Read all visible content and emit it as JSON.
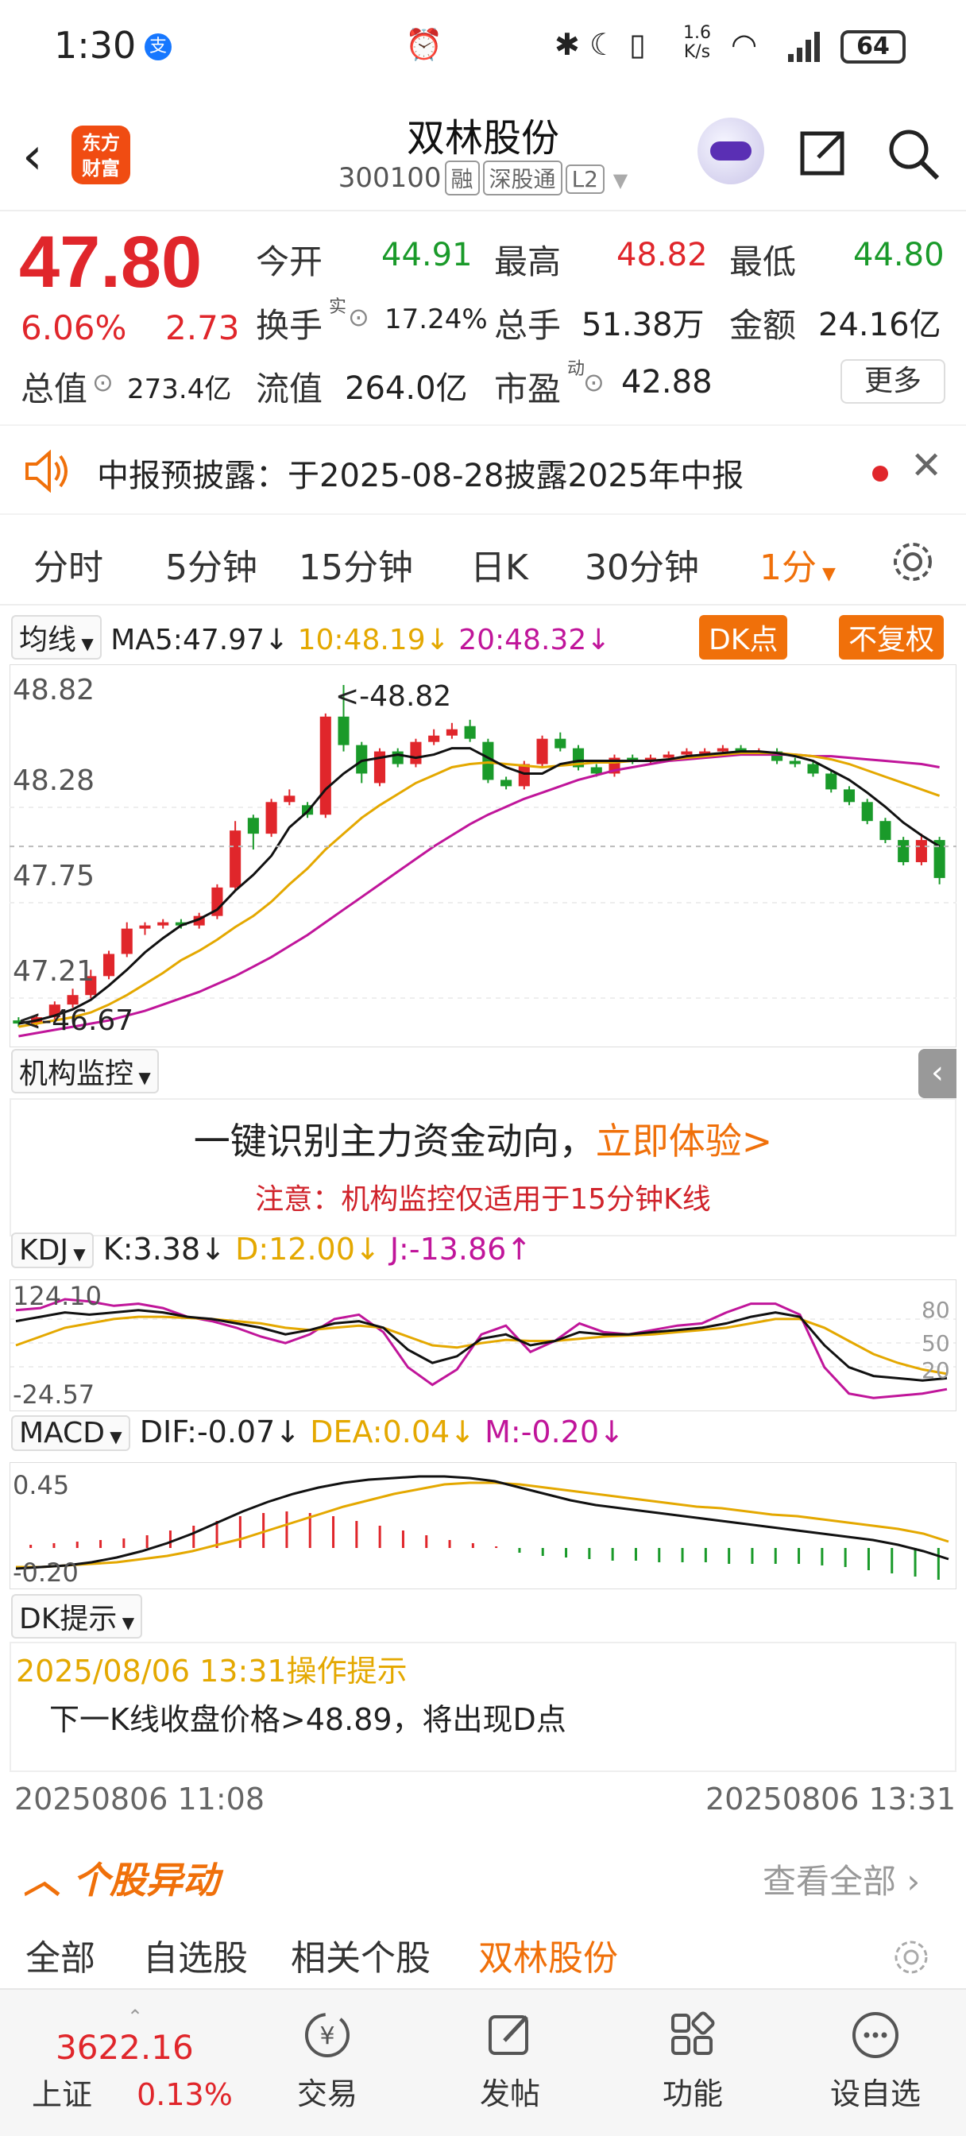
{
  "status_bar": {
    "time": "1:30",
    "pay_glyph": "支",
    "speed_top": "1.6",
    "speed_bottom": "K/s",
    "battery": "64"
  },
  "header": {
    "logo_line1": "东方",
    "logo_line2": "财富",
    "name": "双林股份",
    "code": "300100",
    "tags": [
      "融",
      "深股通",
      "L2"
    ]
  },
  "quote": {
    "price": "47.80",
    "pct": "6.06%",
    "change": "2.73",
    "open_label": "今开",
    "open": "44.91",
    "high_label": "最高",
    "high": "48.82",
    "low_label": "最低",
    "low": "44.80",
    "turnover_label": "换手",
    "turnover_sup": "实",
    "turnover": "17.24%",
    "volume_label": "总手",
    "volume": "51.38万",
    "amount_label": "金额",
    "amount": "24.16亿",
    "mcap_label": "总值",
    "mcap": "273.4亿",
    "float_label": "流值",
    "float": "264.0亿",
    "pe_label": "市盈",
    "pe_sup": "动",
    "pe": "42.88",
    "more": "更多"
  },
  "notice": {
    "text": "中报预披露：于2025-08-28披露2025年中报"
  },
  "periods": [
    "分时",
    "5分钟",
    "15分钟",
    "日K",
    "30分钟",
    "1分"
  ],
  "main_indicator": {
    "selector": "均线",
    "ma5": "MA5:47.97",
    "ma10": "10:48.19",
    "ma20": "20:48.32",
    "dk_button": "DK点",
    "fq_button": "不复权"
  },
  "price_axis": [
    "48.82",
    "48.28",
    "47.75",
    "47.21"
  ],
  "price_labels": {
    "high_marker": "<-48.82",
    "low_marker": "<-46.67"
  },
  "colors": {
    "up": "#e0262b",
    "down": "#1a9a2a",
    "accent": "#f0700a",
    "ma5": "#111111",
    "ma10": "#e4a800",
    "ma20": "#c0159a"
  },
  "institution": {
    "selector": "机构监控",
    "headline": "一键识别主力资金动向，",
    "cta": "立即体验>",
    "note": "注意：机构监控仅适用于15分钟K线"
  },
  "kdj": {
    "selector": "KDJ",
    "k": "K:3.38",
    "d": "D:12.00",
    "j": "J:-13.86",
    "top": "124.10",
    "bottom": "-24.57",
    "levels": [
      "80",
      "50",
      "20"
    ]
  },
  "macd": {
    "selector": "MACD",
    "dif": "DIF:-0.07",
    "dea": "DEA:0.04",
    "m": "M:-0.20",
    "top": "0.45",
    "bottom": "-0.20"
  },
  "dk_hint": {
    "selector": "DK提示",
    "title": "2025/08/06 13:31操作提示",
    "body": "下一K线收盘价格>48.89，将出现D点"
  },
  "time_range": {
    "start": "20250806 11:08",
    "end": "20250806 13:31"
  },
  "movers": {
    "title": "个股异动",
    "view_all": "查看全部"
  },
  "filters": [
    "全部",
    "自选股",
    "相关个股",
    "双林股份"
  ],
  "bottom_nav": {
    "index_value": "3622.16",
    "index_name": "上证",
    "index_pct": "0.13%",
    "items": [
      "交易",
      "发帖",
      "功能",
      "设自选"
    ]
  },
  "chart_data": {
    "type": "candlestick",
    "ylim": [
      46.6,
      48.85
    ],
    "candles": [
      [
        46.7,
        46.68,
        46.72,
        46.66
      ],
      [
        46.68,
        46.72,
        46.74,
        46.66
      ],
      [
        46.72,
        46.8,
        46.82,
        46.7
      ],
      [
        46.8,
        46.86,
        46.9,
        46.78
      ],
      [
        46.86,
        46.98,
        47.02,
        46.84
      ],
      [
        46.98,
        47.12,
        47.14,
        46.96
      ],
      [
        47.12,
        47.28,
        47.32,
        47.1
      ],
      [
        47.28,
        47.3,
        47.32,
        47.24
      ],
      [
        47.3,
        47.32,
        47.34,
        47.28
      ],
      [
        47.32,
        47.3,
        47.34,
        47.28
      ],
      [
        47.3,
        47.36,
        47.38,
        47.28
      ],
      [
        47.36,
        47.54,
        47.56,
        47.34
      ],
      [
        47.54,
        47.9,
        47.96,
        47.52
      ],
      [
        47.98,
        47.88,
        48.0,
        47.78
      ],
      [
        47.88,
        48.08,
        48.1,
        47.86
      ],
      [
        48.08,
        48.12,
        48.16,
        48.06
      ],
      [
        48.06,
        48.0,
        48.08,
        47.98
      ],
      [
        48.0,
        48.62,
        48.64,
        47.98
      ],
      [
        48.62,
        48.44,
        48.82,
        48.4
      ],
      [
        48.44,
        48.26,
        48.46,
        48.2
      ],
      [
        48.2,
        48.4,
        48.42,
        48.18
      ],
      [
        48.4,
        48.32,
        48.42,
        48.3
      ],
      [
        48.32,
        48.46,
        48.48,
        48.3
      ],
      [
        48.46,
        48.5,
        48.54,
        48.44
      ],
      [
        48.5,
        48.54,
        48.58,
        48.48
      ],
      [
        48.56,
        48.48,
        48.6,
        48.46
      ],
      [
        48.46,
        48.22,
        48.48,
        48.2
      ],
      [
        48.22,
        48.18,
        48.24,
        48.16
      ],
      [
        48.18,
        48.32,
        48.34,
        48.16
      ],
      [
        48.32,
        48.48,
        48.5,
        48.3
      ],
      [
        48.48,
        48.42,
        48.52,
        48.4
      ],
      [
        48.42,
        48.3,
        48.44,
        48.28
      ],
      [
        48.3,
        48.26,
        48.32,
        48.24
      ],
      [
        48.26,
        48.36,
        48.38,
        48.24
      ],
      [
        48.36,
        48.34,
        48.38,
        48.32
      ],
      [
        48.34,
        48.36,
        48.38,
        48.32
      ],
      [
        48.36,
        48.38,
        48.4,
        48.34
      ],
      [
        48.38,
        48.4,
        48.42,
        48.36
      ],
      [
        48.4,
        48.4,
        48.42,
        48.38
      ],
      [
        48.4,
        48.42,
        48.44,
        48.38
      ],
      [
        48.42,
        48.4,
        48.44,
        48.38
      ],
      [
        48.4,
        48.4,
        48.42,
        48.38
      ],
      [
        48.4,
        48.34,
        48.42,
        48.32
      ],
      [
        48.34,
        48.32,
        48.36,
        48.3
      ],
      [
        48.32,
        48.26,
        48.34,
        48.24
      ],
      [
        48.26,
        48.16,
        48.28,
        48.14
      ],
      [
        48.16,
        48.08,
        48.18,
        48.06
      ],
      [
        48.08,
        47.96,
        48.1,
        47.94
      ],
      [
        47.96,
        47.84,
        47.98,
        47.82
      ],
      [
        47.84,
        47.7,
        47.86,
        47.68
      ],
      [
        47.7,
        47.84,
        47.88,
        47.68
      ],
      [
        47.84,
        47.6,
        47.86,
        47.56
      ]
    ],
    "ma5": [
      46.68,
      46.7,
      46.73,
      46.77,
      46.83,
      46.92,
      47.02,
      47.13,
      47.22,
      47.3,
      47.34,
      47.4,
      47.52,
      47.62,
      47.74,
      47.92,
      48.02,
      48.16,
      48.26,
      48.34,
      48.36,
      48.38,
      48.36,
      48.38,
      48.42,
      48.42,
      48.36,
      48.3,
      48.26,
      48.26,
      48.32,
      48.34,
      48.34,
      48.34,
      48.34,
      48.34,
      48.35,
      48.37,
      48.38,
      48.39,
      48.4,
      48.4,
      48.39,
      48.37,
      48.34,
      48.28,
      48.22,
      48.14,
      48.05,
      47.95,
      47.87,
      47.8
    ],
    "ma10": [
      46.66,
      46.68,
      46.7,
      46.72,
      46.75,
      46.8,
      46.86,
      46.93,
      47.0,
      47.08,
      47.14,
      47.21,
      47.29,
      47.36,
      47.45,
      47.56,
      47.66,
      47.78,
      47.88,
      47.98,
      48.06,
      48.13,
      48.2,
      48.25,
      48.3,
      48.32,
      48.33,
      48.32,
      48.31,
      48.3,
      48.31,
      48.32,
      48.33,
      48.33,
      48.34,
      48.34,
      48.35,
      48.36,
      48.37,
      48.38,
      48.39,
      48.39,
      48.39,
      48.38,
      48.37,
      48.35,
      48.32,
      48.28,
      48.24,
      48.2,
      48.16,
      48.12
    ],
    "ma20": [
      46.6,
      46.62,
      46.64,
      46.66,
      46.68,
      46.7,
      46.73,
      46.76,
      46.8,
      46.84,
      46.88,
      46.93,
      46.98,
      47.04,
      47.1,
      47.17,
      47.24,
      47.32,
      47.4,
      47.48,
      47.56,
      47.64,
      47.72,
      47.8,
      47.87,
      47.94,
      48.0,
      48.05,
      48.1,
      48.14,
      48.18,
      48.22,
      48.25,
      48.28,
      48.3,
      48.32,
      48.34,
      48.35,
      48.36,
      48.37,
      48.38,
      48.38,
      48.38,
      48.38,
      48.37,
      48.37,
      48.36,
      48.35,
      48.34,
      48.33,
      48.32,
      48.3
    ],
    "kdj_k": [
      0.72,
      0.76,
      0.8,
      0.78,
      0.8,
      0.82,
      0.8,
      0.76,
      0.74,
      0.7,
      0.66,
      0.6,
      0.64,
      0.7,
      0.72,
      0.66,
      0.46,
      0.34,
      0.4,
      0.56,
      0.6,
      0.5,
      0.54,
      0.62,
      0.6,
      0.6,
      0.62,
      0.64,
      0.66,
      0.7,
      0.76,
      0.8,
      0.76,
      0.5,
      0.3,
      0.22,
      0.2,
      0.18,
      0.2
    ],
    "kdj_d": [
      0.5,
      0.58,
      0.66,
      0.7,
      0.74,
      0.76,
      0.76,
      0.75,
      0.74,
      0.72,
      0.7,
      0.66,
      0.64,
      0.66,
      0.68,
      0.66,
      0.58,
      0.5,
      0.48,
      0.52,
      0.55,
      0.54,
      0.54,
      0.56,
      0.58,
      0.59,
      0.6,
      0.62,
      0.64,
      0.66,
      0.7,
      0.74,
      0.74,
      0.66,
      0.54,
      0.42,
      0.34,
      0.28,
      0.24
    ],
    "kdj_j": [
      0.82,
      0.84,
      0.92,
      0.9,
      0.86,
      0.88,
      0.84,
      0.76,
      0.72,
      0.66,
      0.58,
      0.52,
      0.6,
      0.74,
      0.78,
      0.62,
      0.3,
      0.14,
      0.28,
      0.6,
      0.68,
      0.44,
      0.54,
      0.7,
      0.62,
      0.6,
      0.64,
      0.68,
      0.7,
      0.8,
      0.88,
      0.88,
      0.78,
      0.3,
      0.06,
      0.02,
      0.04,
      0.06,
      0.1
    ],
    "macd_dif": [
      -0.13,
      -0.12,
      -0.11,
      -0.09,
      -0.06,
      -0.02,
      0.03,
      0.09,
      0.16,
      0.23,
      0.29,
      0.34,
      0.38,
      0.41,
      0.43,
      0.44,
      0.45,
      0.45,
      0.44,
      0.42,
      0.38,
      0.34,
      0.3,
      0.27,
      0.25,
      0.23,
      0.21,
      0.19,
      0.17,
      0.15,
      0.13,
      0.11,
      0.09,
      0.07,
      0.05,
      0.02,
      -0.02,
      -0.07
    ],
    "macd_dea": [
      -0.12,
      -0.12,
      -0.11,
      -0.1,
      -0.09,
      -0.07,
      -0.05,
      -0.02,
      0.02,
      0.06,
      0.11,
      0.16,
      0.21,
      0.26,
      0.3,
      0.34,
      0.37,
      0.4,
      0.41,
      0.41,
      0.4,
      0.38,
      0.36,
      0.34,
      0.32,
      0.3,
      0.28,
      0.26,
      0.25,
      0.23,
      0.21,
      0.2,
      0.18,
      0.16,
      0.14,
      0.12,
      0.09,
      0.04
    ],
    "macd_m": [
      0.02,
      0.03,
      0.04,
      0.05,
      0.06,
      0.08,
      0.11,
      0.14,
      0.17,
      0.2,
      0.22,
      0.23,
      0.22,
      0.2,
      0.17,
      0.14,
      0.11,
      0.08,
      0.05,
      0.03,
      0.01,
      -0.03,
      -0.05,
      -0.06,
      -0.07,
      -0.08,
      -0.08,
      -0.09,
      -0.09,
      -0.09,
      -0.1,
      -0.1,
      -0.1,
      -0.1,
      -0.11,
      -0.12,
      -0.14,
      -0.16,
      -0.18,
      -0.2
    ]
  }
}
